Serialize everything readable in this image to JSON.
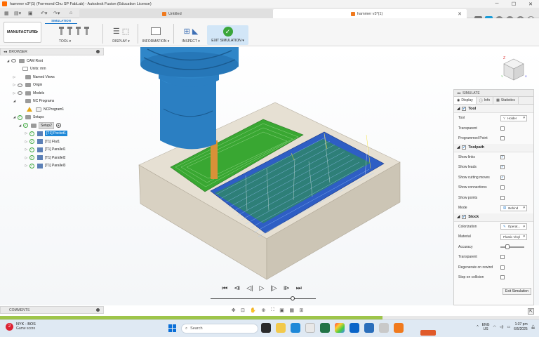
{
  "window": {
    "title": "hammer v3*(1) (Forrmond Chu SP FabLab) - Autodesk Fusion (Education License)",
    "minimize": "─",
    "maximize": "☐",
    "close": "✕"
  },
  "tabs": [
    {
      "label": "Untitled"
    },
    {
      "label": "hammer v3*(1)"
    }
  ],
  "toolbar": {
    "workspace": "MANUFACTURE",
    "ribbon_tab": "SIMULATION",
    "groups": {
      "tool": "TOOL ▾",
      "display": "DISPLAY ▾",
      "information": "INFORMATION ▾",
      "inspect": "INSPECT ▾",
      "exit": "EXIT SIMULATION ▾"
    }
  },
  "browser": {
    "header": "BROWSER",
    "items": [
      {
        "label": "CAM Root"
      },
      {
        "label": "Units: mm"
      },
      {
        "label": "Named Views"
      },
      {
        "label": "Origin"
      },
      {
        "label": "Models"
      },
      {
        "label": "NC Programs"
      },
      {
        "label": "NCProgram1"
      },
      {
        "label": "Setups"
      },
      {
        "label": "Setup2"
      },
      {
        "label": "[T1] Pocket1"
      },
      {
        "label": "[T1] Flat1"
      },
      {
        "label": "[T1] Parallel1"
      },
      {
        "label": "[T1] Parallel2"
      },
      {
        "label": "[T1] Parallel3"
      }
    ]
  },
  "simulate": {
    "header": "SIMULATE",
    "tabs": [
      "Display",
      "Info",
      "Statistics"
    ],
    "tool_section": {
      "title": "Tool",
      "rows": [
        {
          "label": "Tool",
          "value": "Holder"
        },
        {
          "label": "Transparent",
          "checked": false
        },
        {
          "label": "Programmed Point",
          "checked": false
        }
      ]
    },
    "toolpath_section": {
      "title": "Toolpath",
      "rows": [
        {
          "label": "Show links",
          "checked": true
        },
        {
          "label": "Show leads",
          "checked": true
        },
        {
          "label": "Show cutting moves",
          "checked": true
        },
        {
          "label": "Show connections",
          "checked": false
        },
        {
          "label": "Show points",
          "checked": false
        },
        {
          "label": "Mode",
          "value": "Behind"
        }
      ]
    },
    "stock_section": {
      "title": "Stock",
      "rows": [
        {
          "label": "Colorization",
          "value": "Operat..."
        },
        {
          "label": "Material",
          "value": "Plastic Vinyl"
        },
        {
          "label": "Accuracy",
          "value": 0.2
        },
        {
          "label": "Transparent",
          "checked": false
        },
        {
          "label": "Regenerate on rewind",
          "checked": false
        },
        {
          "label": "Stop on collision",
          "checked": false
        }
      ]
    },
    "exit_button": "Exit Simulation"
  },
  "playback": {
    "position": 0.78
  },
  "comments": {
    "header": "COMMENTS"
  },
  "progress": {
    "fraction": 0.71
  },
  "taskbar": {
    "weather_badge": "2",
    "weather_title": "NYK - BOS",
    "weather_sub": "Game score",
    "search_placeholder": "Search",
    "lang_top": "ENG",
    "lang_bottom": "US",
    "time": "1:37 pm",
    "date": "6/5/2025"
  },
  "colors": {
    "accent": "#1a75c9",
    "stock": "#e4ddd0",
    "tool": "#2b7fc2",
    "green_surface": "#3fb53a",
    "toolpath_blue": "#1c3fbf"
  }
}
